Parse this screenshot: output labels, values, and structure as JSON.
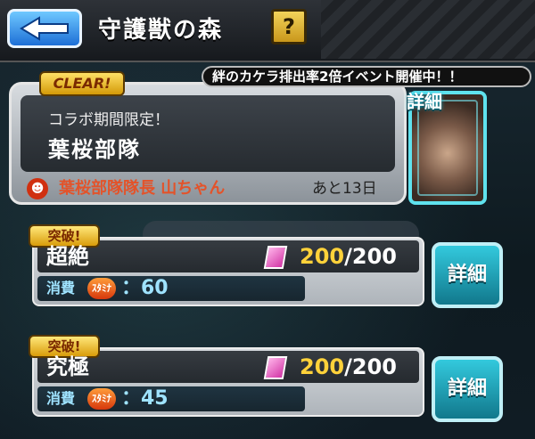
{
  "header": {
    "title": "守護獣の森",
    "help_label": "?"
  },
  "event_banner": "絆のカケラ排出率2倍イベント開催中！！",
  "collab": {
    "clear_badge": "CLEAR!",
    "subtitle": "コラボ期間限定！",
    "quest_name": "葉桜部隊",
    "boss_name": "葉桜部隊隊長 山ちゃん",
    "remaining": "あと13日",
    "detail_label": "詳細"
  },
  "quests": [
    {
      "badge": "突破!",
      "difficulty": "超絶",
      "current": "200",
      "max": "/200",
      "cost_label": "消費",
      "stamina_label": "ｽﾀﾐﾅ",
      "cost_value": "：60",
      "detail_label": "詳細"
    },
    {
      "badge": "突破!",
      "difficulty": "究極",
      "current": "200",
      "max": "/200",
      "cost_label": "消費",
      "stamina_label": "ｽﾀﾐﾅ",
      "cost_value": "：45",
      "detail_label": "詳細"
    }
  ],
  "icons": {
    "back": "left-arrow-icon",
    "boss": "devil-icon",
    "gem": "pink-crystal-icon",
    "stamina": "stamina-icon"
  },
  "colors": {
    "accent_blue": "#1d6fd6",
    "gold": "#ffd23a",
    "teal": "#33c9dd",
    "boss_red": "#e3532a"
  }
}
